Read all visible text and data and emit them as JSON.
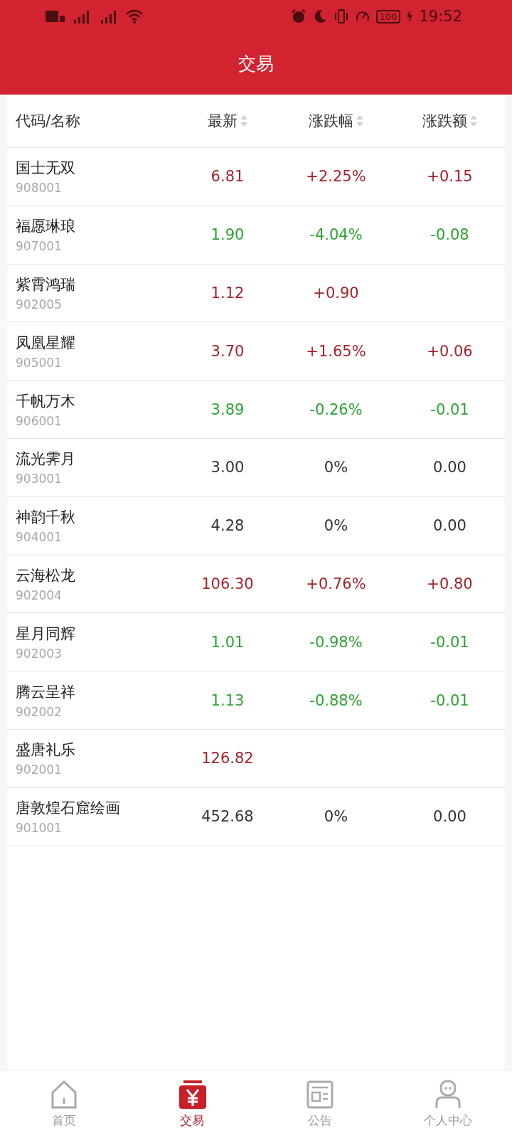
{
  "status_bar": {
    "battery": "100",
    "time": "19:52"
  },
  "header": {
    "title": "交易"
  },
  "table": {
    "columns": [
      {
        "label": "代码/名称",
        "sortable": false
      },
      {
        "label": "最新",
        "sortable": true
      },
      {
        "label": "涨跌幅",
        "sortable": true
      },
      {
        "label": "涨跌额",
        "sortable": true
      }
    ],
    "rows": [
      {
        "name": "国士无双",
        "code": "908001",
        "price": "6.81",
        "change_pct": "+2.25%",
        "change": "+0.15",
        "color": "#a8222a"
      },
      {
        "name": "福愿琳琅",
        "code": "907001",
        "price": "1.90",
        "change_pct": "-4.04%",
        "change": "-0.08",
        "color": "#2aa530"
      },
      {
        "name": "紫霄鸿瑞",
        "code": "902005",
        "price": "1.12",
        "change_pct": "+0.90",
        "color": "#a8222a"
      },
      {
        "name": "凤凰星耀",
        "code": "905001",
        "price": "3.70",
        "change_pct": "+1.65%",
        "change": "+0.06",
        "color": "#a8222a"
      },
      {
        "name": "千帆万木",
        "code": "906001",
        "price": "3.89",
        "change_pct": "-0.26%",
        "change": "-0.01",
        "color": "#2aa530"
      },
      {
        "name": "流光霁月",
        "code": "903001",
        "price": "3.00",
        "change_pct": "0%",
        "change": "0.00",
        "color": "#333333"
      },
      {
        "name": "神韵千秋",
        "code": "904001",
        "price": "4.28",
        "change_pct": "0%",
        "change": "0.00",
        "color": "#333333"
      },
      {
        "name": "云海松龙",
        "code": "902004",
        "price": "106.30",
        "change_pct": "+0.76%",
        "change": "+0.80",
        "color": "#a8222a"
      },
      {
        "name": "星月同辉",
        "code": "902003",
        "price": "1.01",
        "change_pct": "-0.98%",
        "change": "-0.01",
        "color": "#2aa530"
      },
      {
        "name": "腾云呈祥",
        "code": "902002",
        "price": "1.13",
        "change_pct": "-0.88%",
        "change": "-0.01",
        "color": "#2aa530"
      },
      {
        "name": "盛唐礼乐",
        "code": "902001",
        "price": "126.82",
        "color": "#a8222a"
      },
      {
        "name": "唐敦煌石窟绘画",
        "code": "901001",
        "price": "452.68",
        "change_pct": "0%",
        "change": "0.00",
        "color": "#333333"
      }
    ]
  },
  "bottom_nav": [
    {
      "label": "首页",
      "kind": "home",
      "selected": false
    },
    {
      "label": "交易",
      "kind": "trade",
      "selected": true
    },
    {
      "label": "公告",
      "kind": "notice",
      "selected": false
    },
    {
      "label": "个人中心",
      "kind": "profile",
      "selected": false
    }
  ]
}
